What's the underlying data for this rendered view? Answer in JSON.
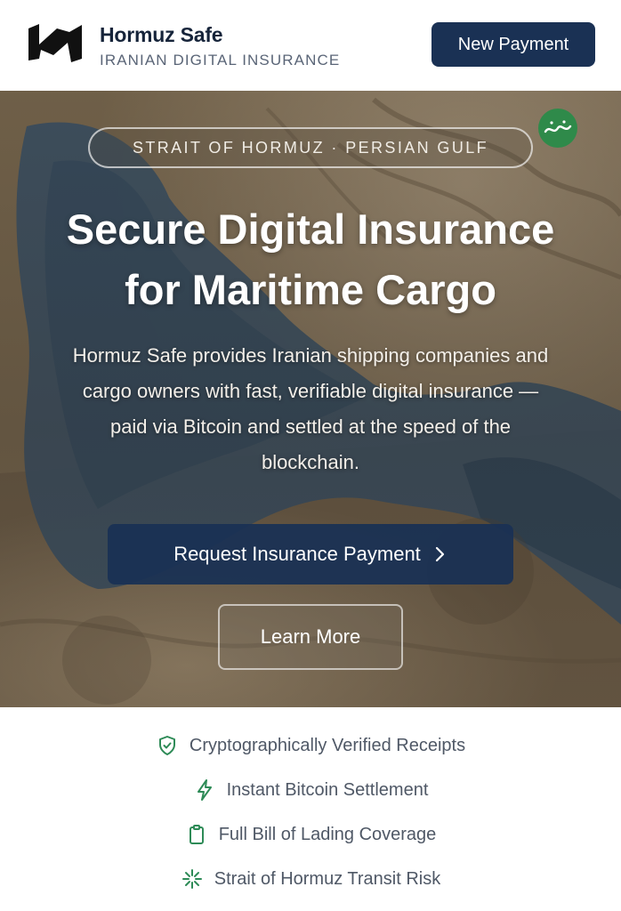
{
  "header": {
    "brand_name": "Hormuz Safe",
    "brand_tagline": "IRANIAN DIGITAL INSURANCE",
    "new_payment_label": "New Payment"
  },
  "hero": {
    "location_pill": "STRAIT OF HORMUZ · PERSIAN GULF",
    "title_line1": "Secure Digital Insurance",
    "title_line2": "for Maritime Cargo",
    "desc_line1": "Hormuz Safe provides Iranian shipping companies and",
    "desc_line2": "cargo owners with fast, verifiable digital insurance —",
    "desc_line3": "paid via Bitcoin and settled at the speed of the",
    "desc_line4": "blockchain.",
    "primary_cta_label": "Request Insurance Payment",
    "secondary_cta_label": "Learn More",
    "watermark_text": "خبرفوری"
  },
  "features": [
    {
      "label": "Cryptographically Verified Receipts",
      "icon": "shield-check-icon"
    },
    {
      "label": "Instant Bitcoin Settlement",
      "icon": "lightning-icon"
    },
    {
      "label": "Full Bill of Lading Coverage",
      "icon": "clipboard-icon"
    },
    {
      "label": "Strait of Hormuz Transit Risk",
      "icon": "route-icon"
    }
  ],
  "colors": {
    "navy": "#1a3154",
    "accent_green": "#2e8b57",
    "text_muted": "#4f5866"
  }
}
